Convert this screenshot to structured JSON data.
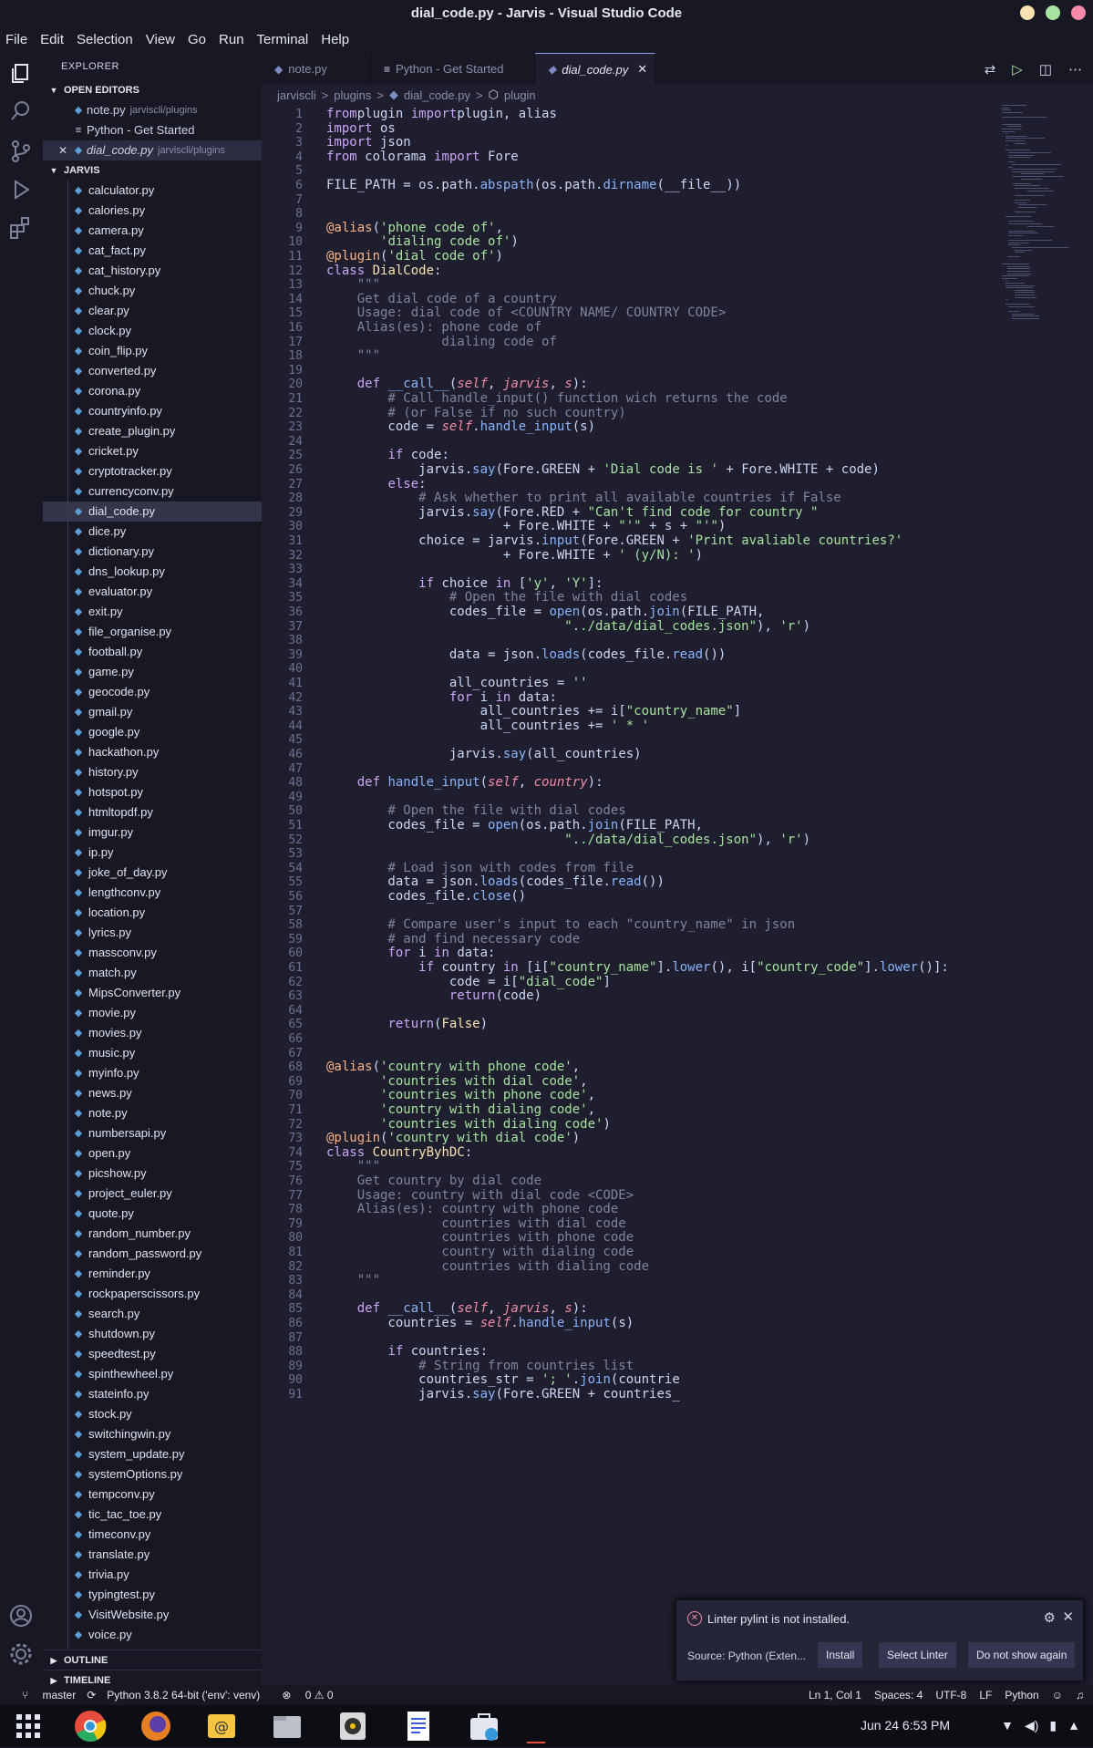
{
  "window": {
    "title": "dial_code.py - Jarvis - Visual Studio Code"
  },
  "menu": [
    "File",
    "Edit",
    "Selection",
    "View",
    "Go",
    "Run",
    "Terminal",
    "Help"
  ],
  "explorer": {
    "header": "EXPLORER",
    "open_editors_label": "OPEN EDITORS",
    "open_editors": [
      {
        "name": "note.py",
        "path": "jarviscli/plugins"
      },
      {
        "name": "Python - Get Started",
        "path": ""
      },
      {
        "name": "dial_code.py",
        "path": "jarviscli/plugins"
      }
    ],
    "project_label": "JARVIS",
    "files": [
      "calculator.py",
      "calories.py",
      "camera.py",
      "cat_fact.py",
      "cat_history.py",
      "chuck.py",
      "clear.py",
      "clock.py",
      "coin_flip.py",
      "converted.py",
      "corona.py",
      "countryinfo.py",
      "create_plugin.py",
      "cricket.py",
      "cryptotracker.py",
      "currencyconv.py",
      "dial_code.py",
      "dice.py",
      "dictionary.py",
      "dns_lookup.py",
      "evaluator.py",
      "exit.py",
      "file_organise.py",
      "football.py",
      "game.py",
      "geocode.py",
      "gmail.py",
      "google.py",
      "hackathon.py",
      "history.py",
      "hotspot.py",
      "htmltopdf.py",
      "imgur.py",
      "ip.py",
      "joke_of_day.py",
      "lengthconv.py",
      "location.py",
      "lyrics.py",
      "massconv.py",
      "match.py",
      "MipsConverter.py",
      "movie.py",
      "movies.py",
      "music.py",
      "myinfo.py",
      "news.py",
      "note.py",
      "numbersapi.py",
      "open.py",
      "picshow.py",
      "project_euler.py",
      "quote.py",
      "random_number.py",
      "random_password.py",
      "reminder.py",
      "rockpaperscissors.py",
      "search.py",
      "shutdown.py",
      "speedtest.py",
      "spinthewheel.py",
      "stateinfo.py",
      "stock.py",
      "switchingwin.py",
      "system_update.py",
      "systemOptions.py",
      "tempconv.py",
      "tic_tac_toe.py",
      "timeconv.py",
      "translate.py",
      "trivia.py",
      "typingtest.py",
      "VisitWebsite.py",
      "voice.py"
    ],
    "selected_file": "dial_code.py",
    "outline_label": "OUTLINE",
    "timeline_label": "TIMELINE"
  },
  "tabs": [
    {
      "label": "note.py",
      "icon": "python-file-icon"
    },
    {
      "label": "Python - Get Started",
      "icon": "doc-icon"
    },
    {
      "label": "dial_code.py",
      "icon": "python-file-icon",
      "active": true
    }
  ],
  "breadcrumb": [
    "jarviscli",
    ">",
    "plugins",
    ">",
    "dial_code.py",
    ">",
    "plugin"
  ],
  "code": [
    [
      [
        "kw",
        "from"
      ],
      [
        "",
        "plugin "
      ],
      [
        "kw",
        "import"
      ],
      [
        "",
        "plugin, alias"
      ]
    ],
    [
      [
        "kw",
        "import"
      ],
      [
        "",
        " os"
      ]
    ],
    [
      [
        "kw",
        "import"
      ],
      [
        "",
        " json"
      ]
    ],
    [
      [
        "kw",
        "from"
      ],
      [
        "",
        " colorama "
      ],
      [
        "kw",
        "import"
      ],
      [
        "",
        " Fore"
      ]
    ],
    [],
    [
      [
        "",
        "FILE_PATH = os.path."
      ],
      [
        "fn",
        "abspath"
      ],
      [
        "",
        "(os.path."
      ],
      [
        "fn",
        "dirname"
      ],
      [
        "",
        "(__file__))"
      ]
    ],
    [],
    [],
    [
      [
        "dc",
        "@alias"
      ],
      [
        "",
        "("
      ],
      [
        "st",
        "'phone code of'"
      ],
      [
        "",
        ","
      ]
    ],
    [
      [
        "",
        "       "
      ],
      [
        "st",
        "'dialing code of'"
      ],
      [
        "",
        ")"
      ]
    ],
    [
      [
        "dc",
        "@plugin"
      ],
      [
        "",
        "("
      ],
      [
        "st",
        "'dial code of'"
      ],
      [
        "",
        ")"
      ]
    ],
    [
      [
        "kw",
        "class"
      ],
      [
        "",
        " "
      ],
      [
        "cs",
        "DialCode"
      ],
      [
        "",
        ":"
      ]
    ],
    [
      [
        "cm",
        "    \"\"\""
      ]
    ],
    [
      [
        "cm",
        "    Get dial code of a country"
      ]
    ],
    [
      [
        "cm",
        "    Usage: dial code of <COUNTRY NAME/ COUNTRY CODE>"
      ]
    ],
    [
      [
        "cm",
        "    Alias(es): phone code of"
      ]
    ],
    [
      [
        "cm",
        "               dialing code of"
      ]
    ],
    [
      [
        "cm",
        "    \"\"\""
      ]
    ],
    [],
    [
      [
        "",
        "    "
      ],
      [
        "kw",
        "def"
      ],
      [
        "",
        " "
      ],
      [
        "fn",
        "__call__"
      ],
      [
        "",
        "("
      ],
      [
        "sf",
        "self"
      ],
      [
        "",
        ", "
      ],
      [
        "pr",
        "jarvis"
      ],
      [
        "",
        ", "
      ],
      [
        "pr",
        "s"
      ],
      [
        "",
        "):"
      ]
    ],
    [
      [
        "cm",
        "        # Call handle_input() function wich returns the code"
      ]
    ],
    [
      [
        "cm",
        "        # (or False if no such country)"
      ]
    ],
    [
      [
        "",
        "        code = "
      ],
      [
        "sf",
        "self"
      ],
      [
        "",
        "."
      ],
      [
        "fn",
        "handle_input"
      ],
      [
        "",
        "(s)"
      ]
    ],
    [],
    [
      [
        "",
        "        "
      ],
      [
        "kw",
        "if"
      ],
      [
        "",
        " code:"
      ]
    ],
    [
      [
        "",
        "            jarvis."
      ],
      [
        "fn",
        "say"
      ],
      [
        "",
        "(Fore.GREEN + "
      ],
      [
        "st",
        "'Dial code is '"
      ],
      [
        "",
        " + Fore.WHITE + code)"
      ]
    ],
    [
      [
        "",
        "        "
      ],
      [
        "kw",
        "else"
      ],
      [
        "",
        ":"
      ]
    ],
    [
      [
        "cm",
        "            # Ask whether to print all available countries if False"
      ]
    ],
    [
      [
        "",
        "            jarvis."
      ],
      [
        "fn",
        "say"
      ],
      [
        "",
        "(Fore.RED + "
      ],
      [
        "st",
        "\"Can't find code for country \""
      ]
    ],
    [
      [
        "",
        "                       + Fore.WHITE + "
      ],
      [
        "st",
        "\"'\""
      ],
      [
        "",
        " + s + "
      ],
      [
        "st",
        "\"'\""
      ],
      [
        "",
        ")"
      ]
    ],
    [
      [
        "",
        "            choice = jarvis."
      ],
      [
        "fn",
        "input"
      ],
      [
        "",
        "(Fore.GREEN + "
      ],
      [
        "st",
        "'Print avaliable countries?'"
      ]
    ],
    [
      [
        "",
        "                       + Fore.WHITE + "
      ],
      [
        "st",
        "' (y/N): '"
      ],
      [
        "",
        ")"
      ]
    ],
    [],
    [
      [
        "",
        "            "
      ],
      [
        "kw",
        "if"
      ],
      [
        "",
        " choice "
      ],
      [
        "kw",
        "in"
      ],
      [
        "",
        " ["
      ],
      [
        "st",
        "'y'"
      ],
      [
        "",
        ", "
      ],
      [
        "st",
        "'Y'"
      ],
      [
        "",
        "]:"
      ]
    ],
    [
      [
        "cm",
        "                # Open the file with dial codes"
      ]
    ],
    [
      [
        "",
        "                codes_file = "
      ],
      [
        "fn",
        "open"
      ],
      [
        "",
        "(os.path."
      ],
      [
        "fn",
        "join"
      ],
      [
        "",
        "(FILE_PATH,"
      ]
    ],
    [
      [
        "",
        "                               "
      ],
      [
        "st",
        "\"../data/dial_codes.json\""
      ],
      [
        "",
        "), "
      ],
      [
        "st",
        "'r'"
      ],
      [
        "",
        ")"
      ]
    ],
    [],
    [
      [
        "",
        "                data = json."
      ],
      [
        "fn",
        "loads"
      ],
      [
        "",
        "(codes_file."
      ],
      [
        "fn",
        "read"
      ],
      [
        "",
        "())"
      ]
    ],
    [],
    [
      [
        "",
        "                all_countries = "
      ],
      [
        "st",
        "''"
      ]
    ],
    [
      [
        "",
        "                "
      ],
      [
        "kw",
        "for"
      ],
      [
        "",
        " i "
      ],
      [
        "kw",
        "in"
      ],
      [
        "",
        " data:"
      ]
    ],
    [
      [
        "",
        "                    all_countries += i["
      ],
      [
        "st",
        "\"country_name\""
      ],
      [
        "",
        "]"
      ]
    ],
    [
      [
        "",
        "                    all_countries += "
      ],
      [
        "st",
        "' * '"
      ]
    ],
    [],
    [
      [
        "",
        "                jarvis."
      ],
      [
        "fn",
        "say"
      ],
      [
        "",
        "(all_countries)"
      ]
    ],
    [],
    [
      [
        "",
        "    "
      ],
      [
        "kw",
        "def"
      ],
      [
        "",
        " "
      ],
      [
        "fn",
        "handle_input"
      ],
      [
        "",
        "("
      ],
      [
        "sf",
        "self"
      ],
      [
        "",
        ", "
      ],
      [
        "pr",
        "country"
      ],
      [
        "",
        "):"
      ]
    ],
    [],
    [
      [
        "cm",
        "        # Open the file with dial codes"
      ]
    ],
    [
      [
        "",
        "        codes_file = "
      ],
      [
        "fn",
        "open"
      ],
      [
        "",
        "(os.path."
      ],
      [
        "fn",
        "join"
      ],
      [
        "",
        "(FILE_PATH,"
      ]
    ],
    [
      [
        "",
        "                               "
      ],
      [
        "st",
        "\"../data/dial_codes.json\""
      ],
      [
        "",
        "), "
      ],
      [
        "st",
        "'r'"
      ],
      [
        "",
        ")"
      ]
    ],
    [],
    [
      [
        "cm",
        "        # Load json with codes from file"
      ]
    ],
    [
      [
        "",
        "        data = json."
      ],
      [
        "fn",
        "loads"
      ],
      [
        "",
        "(codes_file."
      ],
      [
        "fn",
        "read"
      ],
      [
        "",
        "())"
      ]
    ],
    [
      [
        "",
        "        codes_file."
      ],
      [
        "fn",
        "close"
      ],
      [
        "",
        "()"
      ]
    ],
    [],
    [
      [
        "cm",
        "        # Compare user's input to each \"country_name\" in json"
      ]
    ],
    [
      [
        "cm",
        "        # and find necessary code"
      ]
    ],
    [
      [
        "",
        "        "
      ],
      [
        "kw",
        "for"
      ],
      [
        "",
        " i "
      ],
      [
        "kw",
        "in"
      ],
      [
        "",
        " data:"
      ]
    ],
    [
      [
        "",
        "            "
      ],
      [
        "kw",
        "if"
      ],
      [
        "",
        " country "
      ],
      [
        "kw",
        "in"
      ],
      [
        "",
        " [i["
      ],
      [
        "st",
        "\"country_name\""
      ],
      [
        "",
        "]."
      ],
      [
        "fn",
        "lower"
      ],
      [
        "",
        "(), i["
      ],
      [
        "st",
        "\"country_code\""
      ],
      [
        "",
        "]."
      ],
      [
        "fn",
        "lower"
      ],
      [
        "",
        "()]:"
      ]
    ],
    [
      [
        "",
        "                code = i["
      ],
      [
        "st",
        "\"dial_code\""
      ],
      [
        "",
        "]"
      ]
    ],
    [
      [
        "",
        "                "
      ],
      [
        "kw",
        "return"
      ],
      [
        "",
        "(code)"
      ]
    ],
    [],
    [
      [
        "",
        "        "
      ],
      [
        "kw",
        "return"
      ],
      [
        "",
        "("
      ],
      [
        "bi",
        "False"
      ],
      [
        "",
        ")"
      ]
    ],
    [],
    [],
    [
      [
        "dc",
        "@alias"
      ],
      [
        "",
        "("
      ],
      [
        "st",
        "'country with phone code'"
      ],
      [
        "",
        ","
      ]
    ],
    [
      [
        "",
        "       "
      ],
      [
        "st",
        "'countries with dial code'"
      ],
      [
        "",
        ","
      ]
    ],
    [
      [
        "",
        "       "
      ],
      [
        "st",
        "'countries with phone code'"
      ],
      [
        "",
        ","
      ]
    ],
    [
      [
        "",
        "       "
      ],
      [
        "st",
        "'country with dialing code'"
      ],
      [
        "",
        ","
      ]
    ],
    [
      [
        "",
        "       "
      ],
      [
        "st",
        "'countries with dialing code'"
      ],
      [
        "",
        ")"
      ]
    ],
    [
      [
        "dc",
        "@plugin"
      ],
      [
        "",
        "("
      ],
      [
        "st",
        "'country with dial code'"
      ],
      [
        "",
        ")"
      ]
    ],
    [
      [
        "kw",
        "class"
      ],
      [
        "",
        " "
      ],
      [
        "cs",
        "CountryByhDC"
      ],
      [
        "",
        ":"
      ]
    ],
    [
      [
        "cm",
        "    \"\"\""
      ]
    ],
    [
      [
        "cm",
        "    Get country by dial code"
      ]
    ],
    [
      [
        "cm",
        "    Usage: country with dial code <CODE>"
      ]
    ],
    [
      [
        "cm",
        "    Alias(es): country with phone code"
      ]
    ],
    [
      [
        "cm",
        "               countries with dial code"
      ]
    ],
    [
      [
        "cm",
        "               countries with phone code"
      ]
    ],
    [
      [
        "cm",
        "               country with dialing code"
      ]
    ],
    [
      [
        "cm",
        "               countries with dialing code"
      ]
    ],
    [
      [
        "cm",
        "    \"\"\""
      ]
    ],
    [],
    [
      [
        "",
        "    "
      ],
      [
        "kw",
        "def"
      ],
      [
        "",
        " "
      ],
      [
        "fn",
        "__call__"
      ],
      [
        "",
        "("
      ],
      [
        "sf",
        "self"
      ],
      [
        "",
        ", "
      ],
      [
        "pr",
        "jarvis"
      ],
      [
        "",
        ", "
      ],
      [
        "pr",
        "s"
      ],
      [
        "",
        "):"
      ]
    ],
    [
      [
        "",
        "        countries = "
      ],
      [
        "sf",
        "self"
      ],
      [
        "",
        "."
      ],
      [
        "fn",
        "handle_input"
      ],
      [
        "",
        "(s)"
      ]
    ],
    [],
    [
      [
        "",
        "        "
      ],
      [
        "kw",
        "if"
      ],
      [
        "",
        " countries:"
      ]
    ],
    [
      [
        "cm",
        "            # String from countries list"
      ]
    ],
    [
      [
        "",
        "            countries_str = "
      ],
      [
        "st",
        "'; '"
      ],
      [
        "",
        "."
      ],
      [
        "fn",
        "join"
      ],
      [
        "",
        "(countrie"
      ]
    ],
    [
      [
        "",
        "            jarvis."
      ],
      [
        "fn",
        "say"
      ],
      [
        "",
        "(Fore.GREEN + countries_"
      ]
    ]
  ],
  "notification": {
    "message": "Linter pylint is not installed.",
    "source": "Source: Python (Exten...",
    "buttons": [
      "Install",
      "Select Linter",
      "Do not show again"
    ]
  },
  "status": {
    "branch": "master",
    "interpreter": "Python 3.8.2 64-bit ('env': venv)",
    "problems": "0 ⚠ 0",
    "position": "Ln 1, Col 1",
    "spaces": "Spaces: 4",
    "encoding": "UTF-8",
    "eol": "LF",
    "language": "Python"
  },
  "taskbar": {
    "clock": "Jun 24   6:53 PM"
  },
  "colors": {
    "accent": "#8ba4f0",
    "error": "#f38ba8",
    "bg": "#1e1e2e"
  }
}
